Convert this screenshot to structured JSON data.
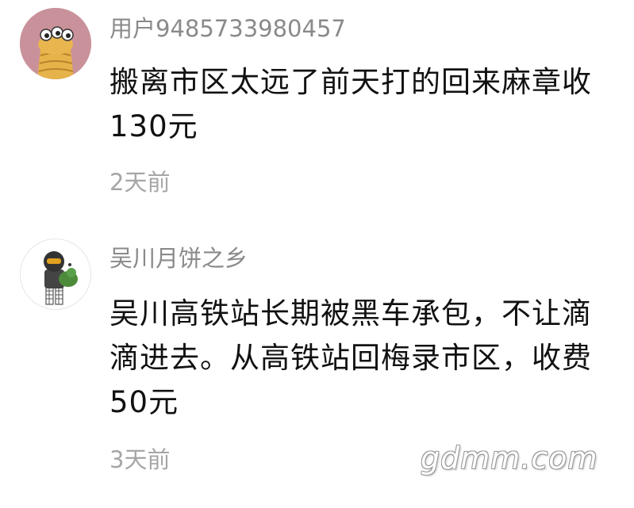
{
  "comments": [
    {
      "username": "用户9485733980457",
      "content": "搬离市区太远了前天打的回来麻章收130元",
      "time": "2天前",
      "avatar_icon": "cartoon-character-avatar-icon",
      "avatar_color": "#c9929a"
    },
    {
      "username": "吴川月饼之乡",
      "content": "吴川高铁站长期被黑车承包，不让滴滴进去。从高铁站回梅录市区，收费50元",
      "time": "3天前",
      "avatar_icon": "helmet-figure-avatar-icon",
      "avatar_color": "#ffffff"
    }
  ],
  "watermark": "gdmm.com"
}
